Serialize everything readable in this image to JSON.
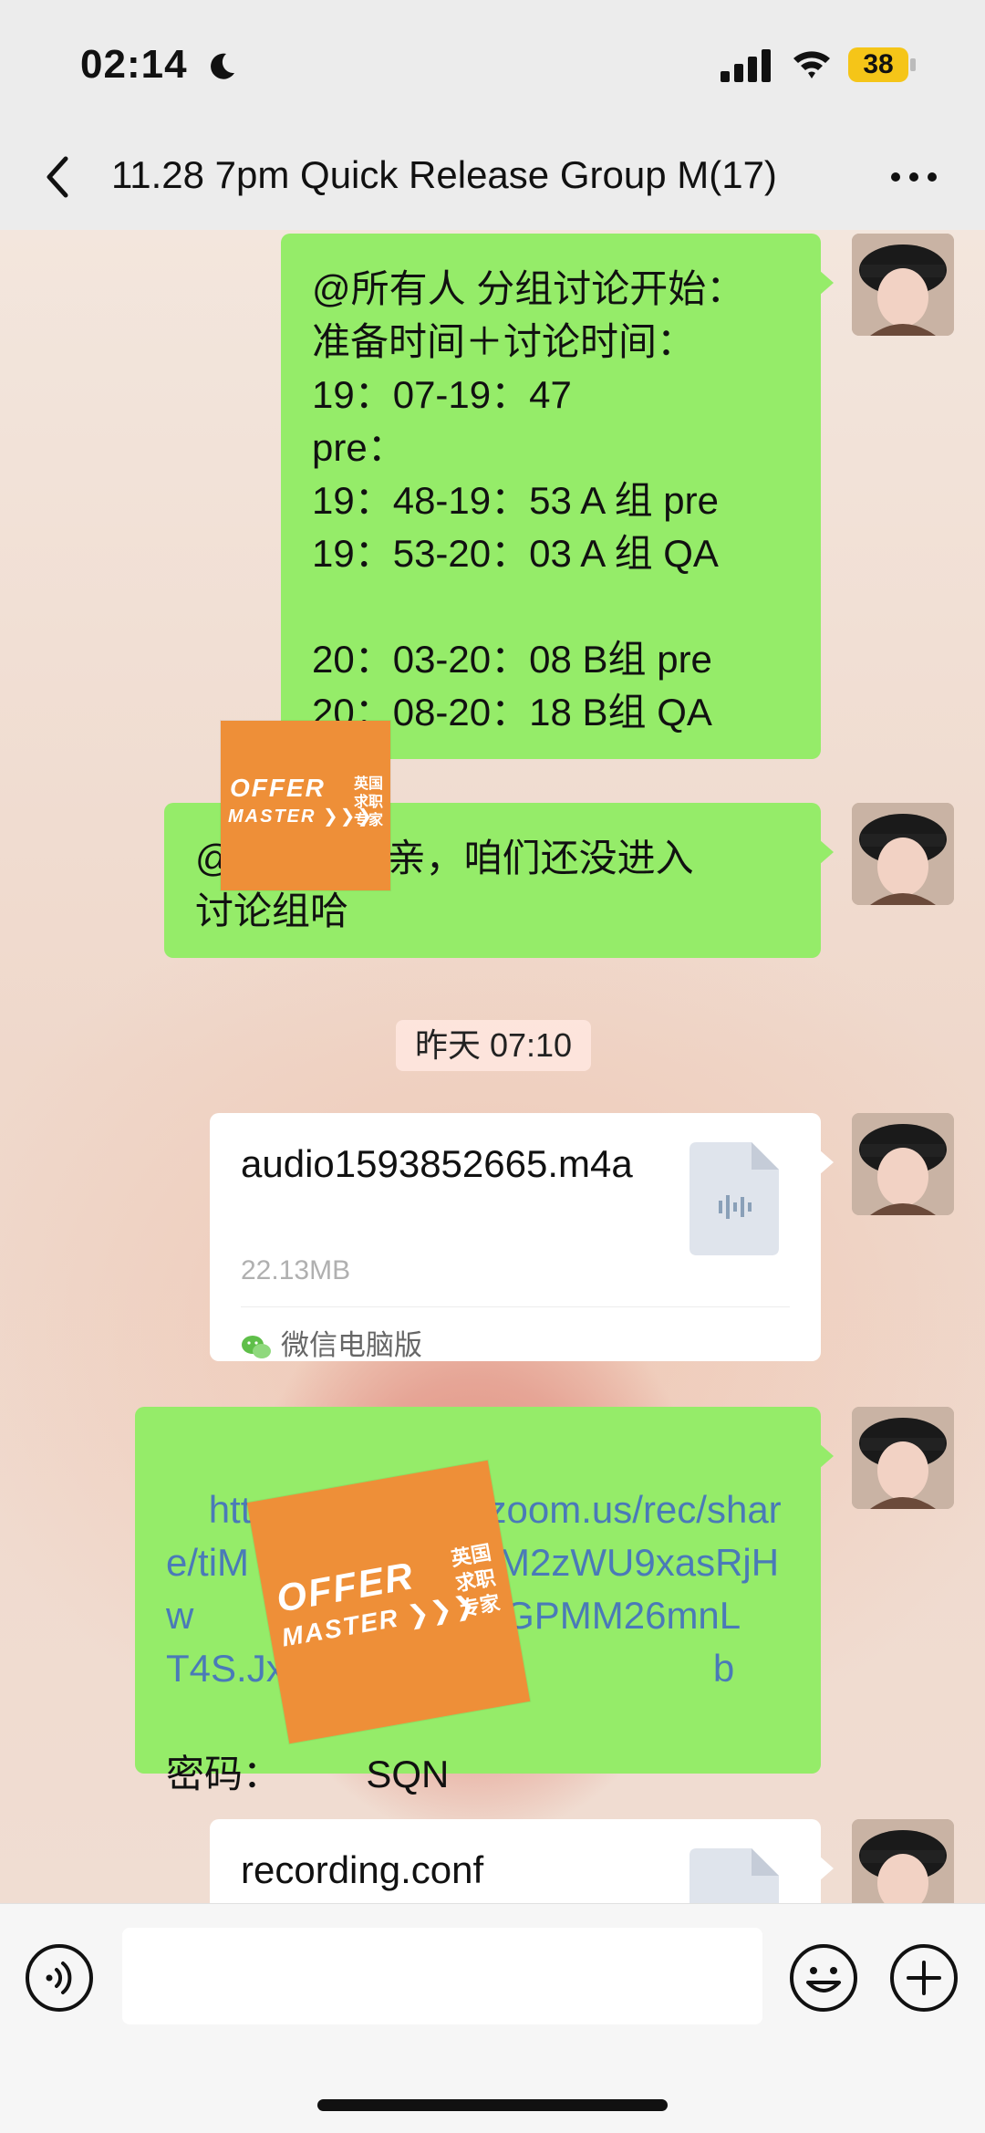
{
  "status": {
    "time": "02:14",
    "battery": "38",
    "moon_icon": "moon-icon"
  },
  "nav": {
    "title": "11.28 7pm Quick Release Group M",
    "count": "(17)",
    "back_icon": "chevron-left-icon",
    "more_icon": "more-dots-icon"
  },
  "messages": [
    {
      "type": "text",
      "text": "@所有人 分组讨论开始：\n准备时间＋讨论时间：\n19：07-19：47\npre：\n19：48-19：53 A 组 pre\n19：53-20：03 A 组 QA\n\n20：03-20：08 B组 pre\n20：08-20：18 B组 QA"
    },
    {
      "type": "text",
      "text": "@        ON 亲，咱们还没进入\n讨论组哈"
    },
    {
      "type": "file",
      "name": "audio1593852665.m4a",
      "size": "22.13MB",
      "source": "微信电脑版"
    },
    {
      "type": "link",
      "text": "https://us02web.zoom.us/rec/share/tiM                    WM2zWU9xasRjHw                    CQI6lGPMM26mnL                    T4S.JxFPjxk4-601h                    b",
      "password_label": "密码：",
      "password_value": "        SQN"
    },
    {
      "type": "file",
      "name": "recording.conf"
    }
  ],
  "timestamp": "昨天 07:10",
  "watermark": {
    "line1": "OFFER",
    "line2": "MASTER",
    "cn1": "英国",
    "cn2": "求职",
    "cn3": "专家"
  },
  "input": {
    "placeholder": "",
    "value": ""
  },
  "colors": {
    "bubble_green": "#95ec69",
    "watermark_orange": "#ee8f38",
    "link": "#4a7ab8"
  }
}
